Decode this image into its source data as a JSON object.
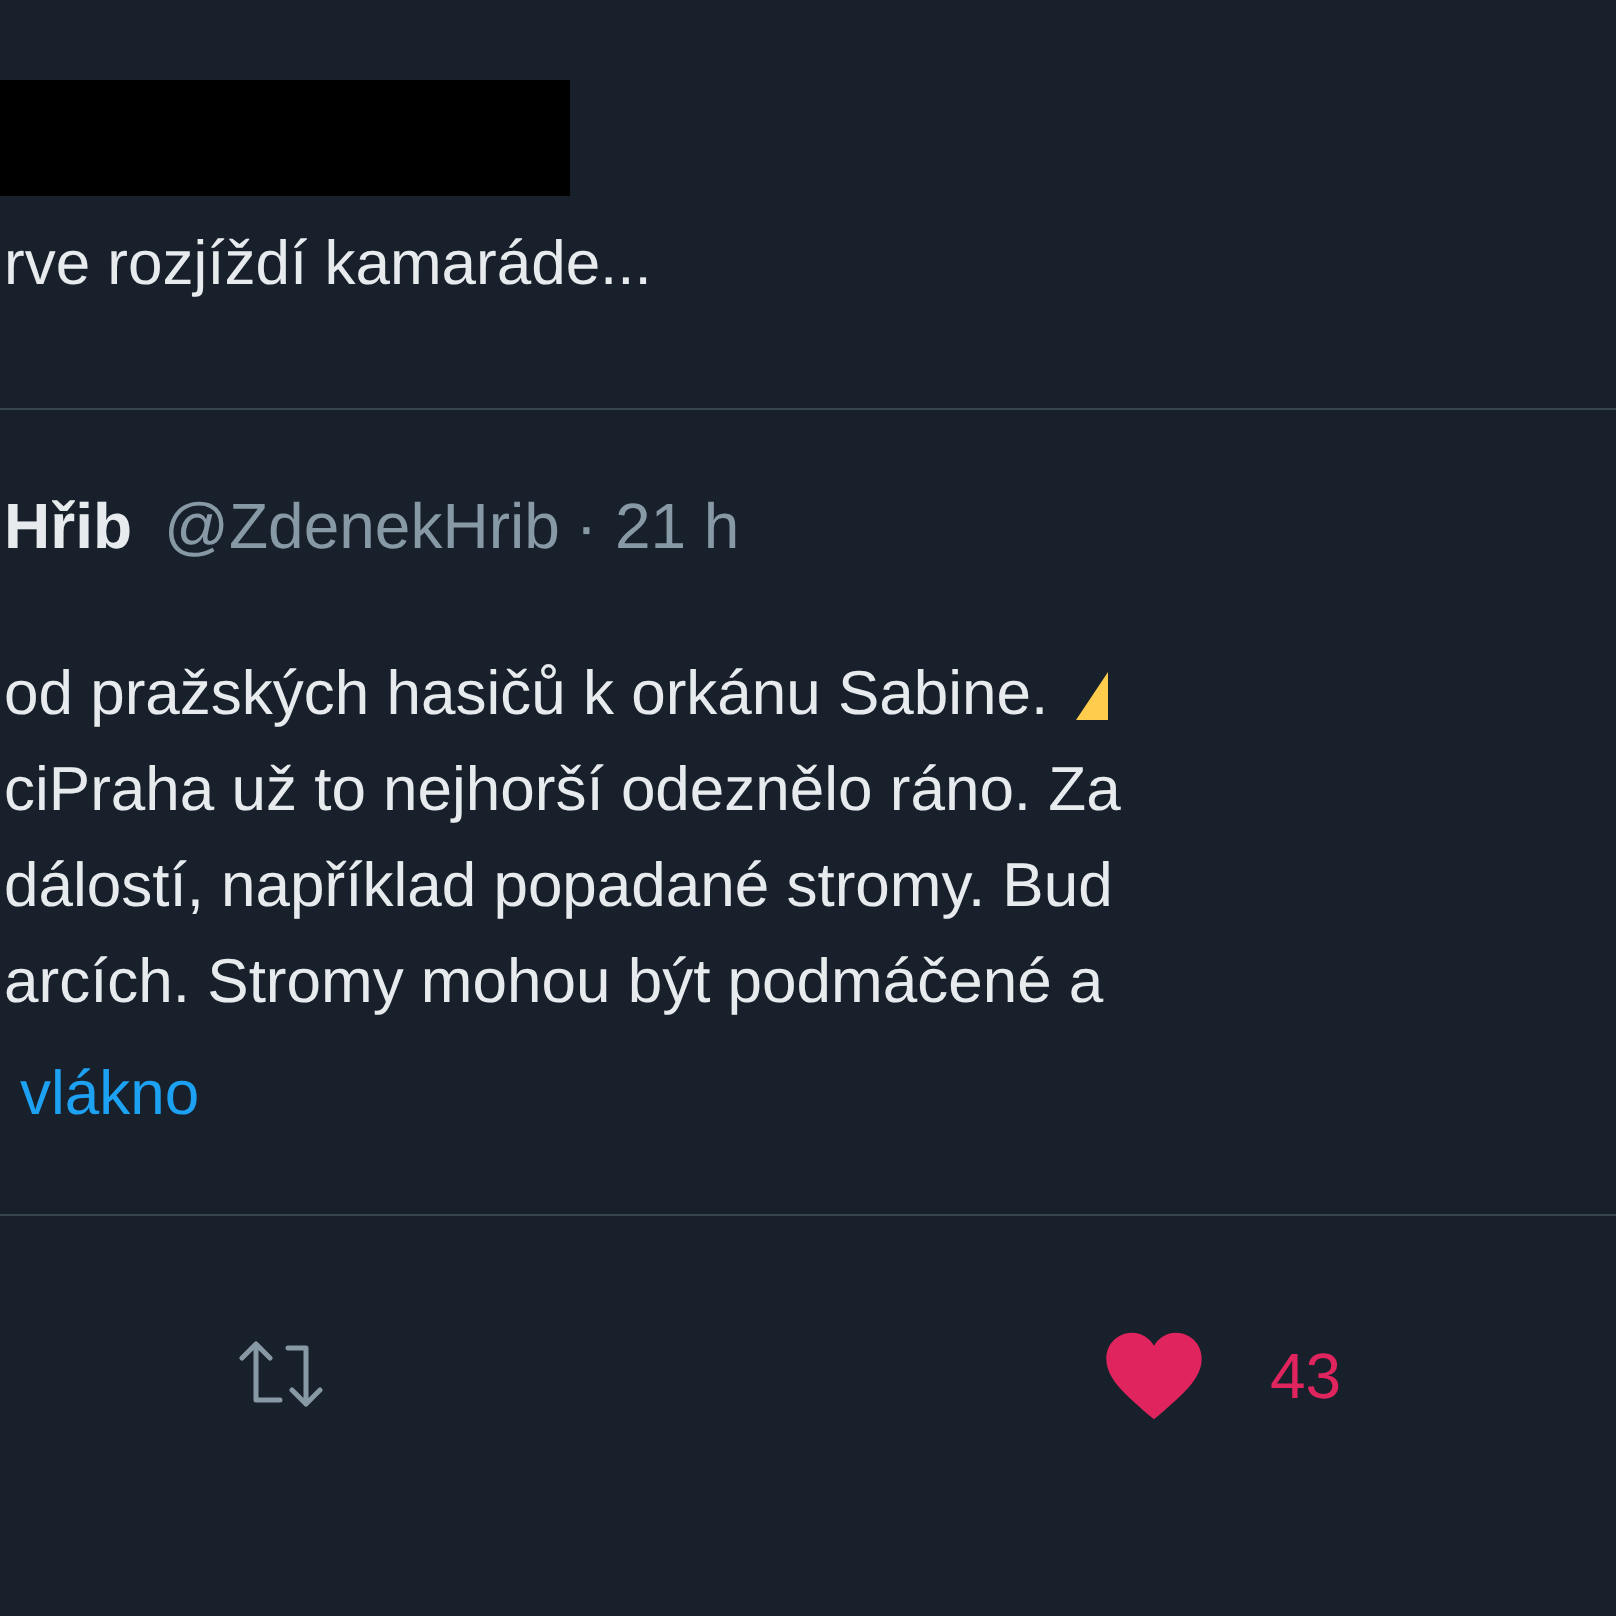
{
  "tweet": {
    "text": "rve rozjíždí kamaráde..."
  },
  "quoted_tweet": {
    "name": "Hřib",
    "handle": "@ZdenekHrib",
    "time": "· 21 h",
    "lines": [
      "od pražských hasičů k orkánu Sabine.",
      "ciPraha už to nejhorší odeznělo ráno. Za",
      "dálostí, například popadané stromy. Bud",
      "arcích. Stromy mohou být podmáčené a"
    ],
    "thread_link": "vlákno"
  },
  "actions": [
    {
      "kind": "retweet",
      "active": false
    },
    {
      "kind": "like",
      "active": true,
      "count": "43"
    }
  ]
}
